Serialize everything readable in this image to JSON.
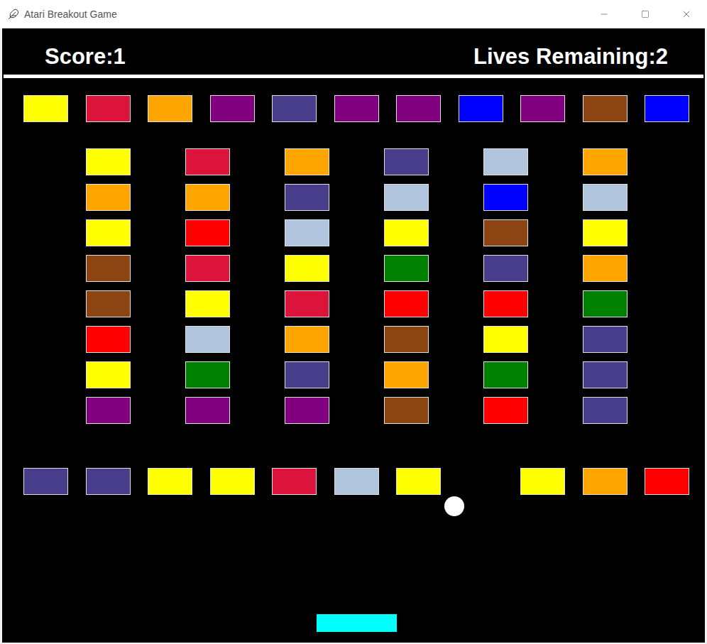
{
  "window": {
    "title": "Atari Breakout Game"
  },
  "hud": {
    "score": "Score:1",
    "lives": "Lives Remaining:2"
  },
  "top_row": [
    {
      "present": true,
      "color": "#ffff00"
    },
    {
      "present": true,
      "color": "#dc143c"
    },
    {
      "present": true,
      "color": "#ffa500"
    },
    {
      "present": true,
      "color": "#800080"
    },
    {
      "present": true,
      "color": "#483d8b"
    },
    {
      "present": true,
      "color": "#800080"
    },
    {
      "present": true,
      "color": "#800080"
    },
    {
      "present": true,
      "color": "#0000ff"
    },
    {
      "present": true,
      "color": "#800080"
    },
    {
      "present": true,
      "color": "#8b4513"
    },
    {
      "present": true,
      "color": "#0000ff"
    }
  ],
  "columns": [
    [
      {
        "present": true,
        "color": "#ffff00"
      },
      {
        "present": true,
        "color": "#ffa500"
      },
      {
        "present": true,
        "color": "#ffff00"
      },
      {
        "present": true,
        "color": "#8b4513"
      },
      {
        "present": true,
        "color": "#8b4513"
      },
      {
        "present": true,
        "color": "#ff0000"
      },
      {
        "present": true,
        "color": "#ffff00"
      },
      {
        "present": true,
        "color": "#800080"
      }
    ],
    [
      {
        "present": true,
        "color": "#dc143c"
      },
      {
        "present": true,
        "color": "#ffa500"
      },
      {
        "present": true,
        "color": "#ff0000"
      },
      {
        "present": true,
        "color": "#dc143c"
      },
      {
        "present": true,
        "color": "#ffff00"
      },
      {
        "present": true,
        "color": "#b0c4de"
      },
      {
        "present": true,
        "color": "#008000"
      },
      {
        "present": true,
        "color": "#800080"
      }
    ],
    [
      {
        "present": true,
        "color": "#ffa500"
      },
      {
        "present": true,
        "color": "#483d8b"
      },
      {
        "present": true,
        "color": "#b0c4de"
      },
      {
        "present": true,
        "color": "#ffff00"
      },
      {
        "present": true,
        "color": "#dc143c"
      },
      {
        "present": true,
        "color": "#ffa500"
      },
      {
        "present": true,
        "color": "#483d8b"
      },
      {
        "present": true,
        "color": "#800080"
      }
    ],
    [
      {
        "present": true,
        "color": "#483d8b"
      },
      {
        "present": true,
        "color": "#b0c4de"
      },
      {
        "present": true,
        "color": "#ffff00"
      },
      {
        "present": true,
        "color": "#008000"
      },
      {
        "present": true,
        "color": "#ff0000"
      },
      {
        "present": true,
        "color": "#8b4513"
      },
      {
        "present": true,
        "color": "#ffa500"
      },
      {
        "present": true,
        "color": "#8b4513"
      }
    ],
    [
      {
        "present": true,
        "color": "#b0c4de"
      },
      {
        "present": true,
        "color": "#0000ff"
      },
      {
        "present": true,
        "color": "#8b4513"
      },
      {
        "present": true,
        "color": "#483d8b"
      },
      {
        "present": true,
        "color": "#ff0000"
      },
      {
        "present": true,
        "color": "#ffff00"
      },
      {
        "present": true,
        "color": "#008000"
      },
      {
        "present": true,
        "color": "#ff0000"
      }
    ],
    [
      {
        "present": true,
        "color": "#ffa500"
      },
      {
        "present": true,
        "color": "#b0c4de"
      },
      {
        "present": true,
        "color": "#ffff00"
      },
      {
        "present": true,
        "color": "#ffa500"
      },
      {
        "present": true,
        "color": "#008000"
      },
      {
        "present": true,
        "color": "#483d8b"
      },
      {
        "present": true,
        "color": "#483d8b"
      },
      {
        "present": true,
        "color": "#483d8b"
      }
    ]
  ],
  "bottom_row": [
    {
      "present": true,
      "color": "#483d8b"
    },
    {
      "present": true,
      "color": "#483d8b"
    },
    {
      "present": true,
      "color": "#ffff00"
    },
    {
      "present": true,
      "color": "#ffff00"
    },
    {
      "present": true,
      "color": "#dc143c"
    },
    {
      "present": true,
      "color": "#b0c4de"
    },
    {
      "present": true,
      "color": "#ffff00"
    },
    {
      "present": false
    },
    {
      "present": true,
      "color": "#ffff00"
    },
    {
      "present": true,
      "color": "#ffa500"
    },
    {
      "present": true,
      "color": "#ff0000"
    }
  ]
}
